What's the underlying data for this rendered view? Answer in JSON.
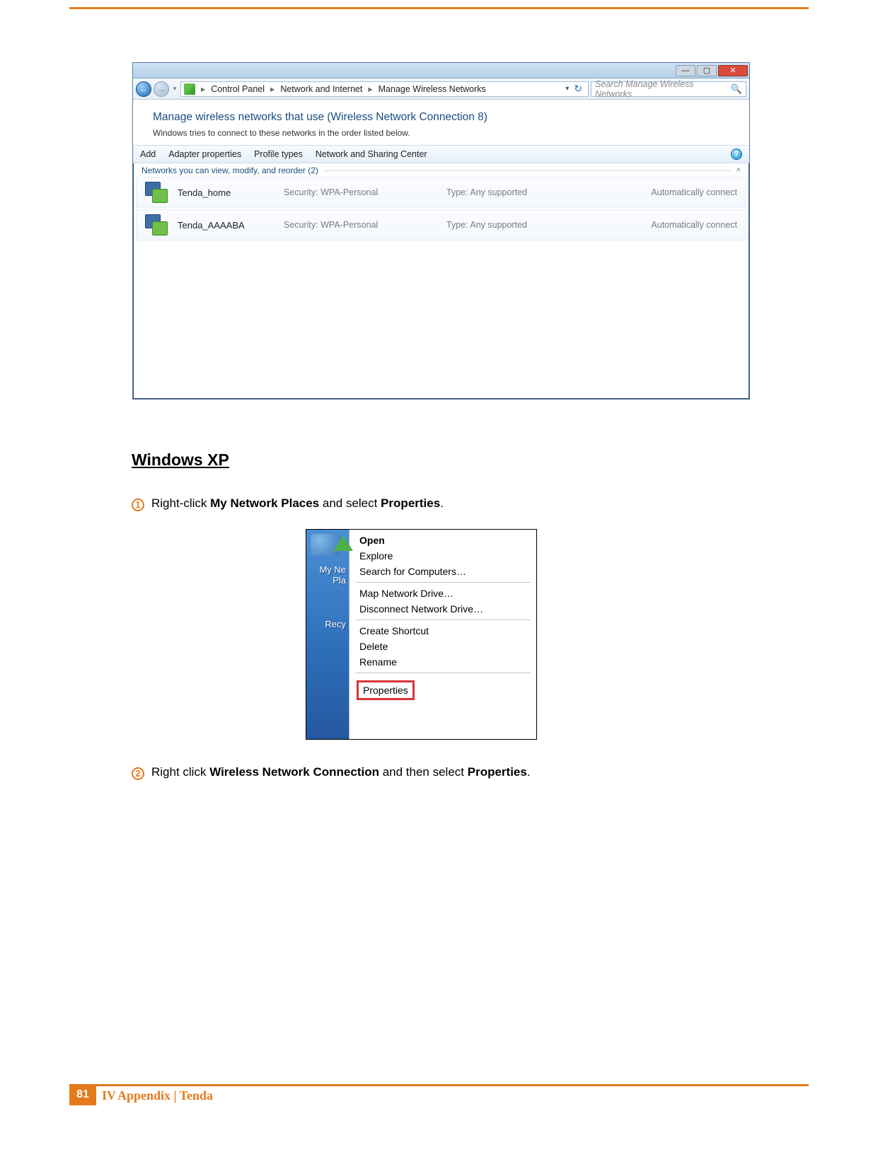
{
  "win7": {
    "breadcrumbs": [
      "Control Panel",
      "Network and Internet",
      "Manage Wireless Networks"
    ],
    "search_placeholder": "Search Manage Wireless Networks",
    "banner_title": "Manage wireless networks that use (Wireless Network Connection 8)",
    "banner_sub": "Windows tries to connect to these networks in the order listed below.",
    "cmd": {
      "add": "Add",
      "adapter": "Adapter properties",
      "profile": "Profile types",
      "nsc": "Network and Sharing Center"
    },
    "group_label": "Networks you can view, modify, and reorder (2)",
    "sec_prefix": "Security:",
    "type_prefix": "Type:",
    "networks": [
      {
        "name": "Tenda_home",
        "security": "WPA-Personal",
        "type": "Any supported",
        "auto": "Automatically connect"
      },
      {
        "name": "Tenda_AAAABA",
        "security": "WPA-Personal",
        "type": "Any supported",
        "auto": "Automatically connect"
      }
    ]
  },
  "section_heading": "Windows XP",
  "steps": {
    "s1_pre": "Right-click ",
    "s1_b1": "My Network Places",
    "s1_mid": " and select ",
    "s1_b2": "Properties",
    "s1_post": ".",
    "s2_pre": "Right click ",
    "s2_b1": "Wireless Network Connection",
    "s2_mid": " and then select ",
    "s2_b2": "Properties",
    "s2_post": "."
  },
  "xp_menu": {
    "left_label_1a": "My Ne",
    "left_label_1b": "Pla",
    "left_label_2": "Recy",
    "items": {
      "open": "Open",
      "explore": "Explore",
      "search": "Search for Computers…",
      "map": "Map Network Drive…",
      "disc": "Disconnect Network Drive…",
      "shortcut": "Create Shortcut",
      "delete": "Delete",
      "rename": "Rename",
      "properties": "Properties"
    }
  },
  "footer": {
    "page_num": "81",
    "roman": "IV",
    "text": " Appendix | Tenda"
  }
}
